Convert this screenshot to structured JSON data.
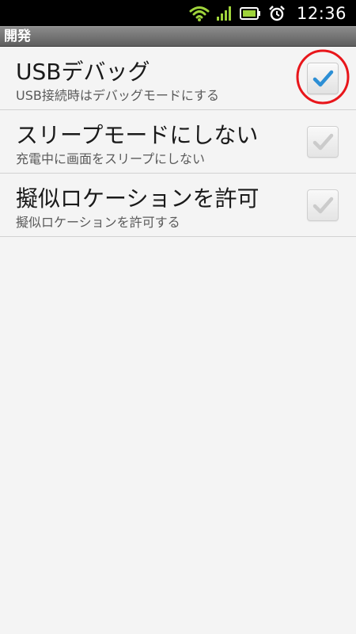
{
  "status_bar": {
    "time": "12:36",
    "icons": [
      "wifi-icon",
      "signal-icon",
      "battery-icon",
      "alarm-icon"
    ],
    "icon_color": "#9fd33b"
  },
  "header": {
    "title": "開発"
  },
  "settings": [
    {
      "title": "USBデバッグ",
      "summary": "USB接続時はデバッグモードにする",
      "checked": true,
      "enabled": true
    },
    {
      "title": "スリープモードにしない",
      "summary": "充電中に画面をスリープにしない",
      "checked": true,
      "enabled": false
    },
    {
      "title": "擬似ロケーションを許可",
      "summary": "擬似ロケーションを許可する",
      "checked": true,
      "enabled": false
    }
  ],
  "colors": {
    "check_active": "#2d8fd5",
    "check_disabled": "#c4c4c4",
    "highlight": "#e8161b"
  }
}
